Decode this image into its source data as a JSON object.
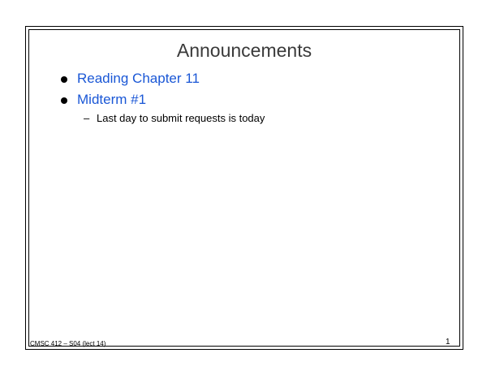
{
  "slide": {
    "title": "Announcements",
    "bullets": [
      {
        "label": "Reading Chapter 11"
      },
      {
        "label": "Midterm #1"
      }
    ],
    "sub_bullets": [
      {
        "dash": "–",
        "label": "Last day to submit requests is today"
      }
    ],
    "footer": {
      "course": "CMSC 412 – S04  (lect 14)",
      "page_number": "1"
    }
  },
  "colors": {
    "bullet_text": "#1a57d6",
    "title_text": "#3a3a3a",
    "body_text": "#000000",
    "background": "#ffffff"
  }
}
